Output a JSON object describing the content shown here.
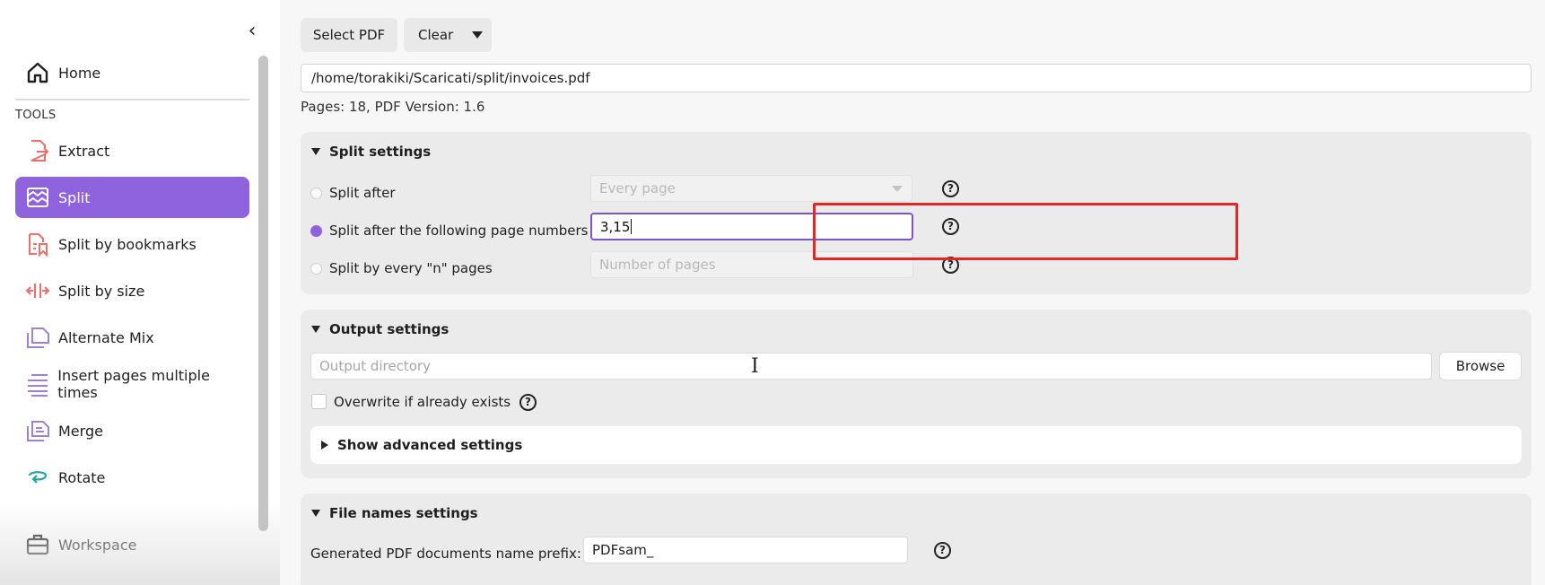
{
  "sidebar": {
    "collapse_icon": "chevron-left-icon",
    "home_label": "Home",
    "tools_label": "TOOLS",
    "items": [
      {
        "label": "Extract",
        "icon": "extract-icon",
        "active": false
      },
      {
        "label": "Split",
        "icon": "split-icon",
        "active": true
      },
      {
        "label": "Split by bookmarks",
        "icon": "bookmarks-icon",
        "active": false
      },
      {
        "label": "Split by size",
        "icon": "split-size-icon",
        "active": false
      },
      {
        "label": "Alternate Mix",
        "icon": "alternate-mix-icon",
        "active": false
      },
      {
        "label": "Insert pages multiple times",
        "icon": "insert-pages-icon",
        "active": false
      },
      {
        "label": "Merge",
        "icon": "merge-icon",
        "active": false
      },
      {
        "label": "Rotate",
        "icon": "rotate-icon",
        "active": false
      }
    ],
    "workspace_label": "Workspace"
  },
  "toolbar": {
    "select_pdf_label": "Select PDF",
    "clear_label": "Clear"
  },
  "file": {
    "path": "/home/torakiki/Scaricati/split/invoices.pdf",
    "info": "Pages: 18, PDF Version: 1.6"
  },
  "split_settings": {
    "title": "Split settings",
    "split_after_label": "Split after",
    "split_after_select": "Every page",
    "split_pages_label": "Split after the following page numbers",
    "split_pages_value": "3,15",
    "split_every_label": "Split by every \"n\" pages",
    "split_every_placeholder": "Number of pages"
  },
  "output_settings": {
    "title": "Output settings",
    "directory_placeholder": "Output directory",
    "browse_label": "Browse",
    "overwrite_label": "Overwrite if already exists",
    "advanced_label": "Show advanced settings"
  },
  "file_names_settings": {
    "title": "File names settings",
    "prefix_label": "Generated PDF documents name prefix:",
    "prefix_value": "PDFsam_"
  },
  "help_glyph": "?",
  "colors": {
    "accent": "#9063de",
    "highlight": "#e32626",
    "icon_red": "#e9706b",
    "icon_purple": "#9b82d8",
    "icon_teal": "#2aa3a3"
  }
}
